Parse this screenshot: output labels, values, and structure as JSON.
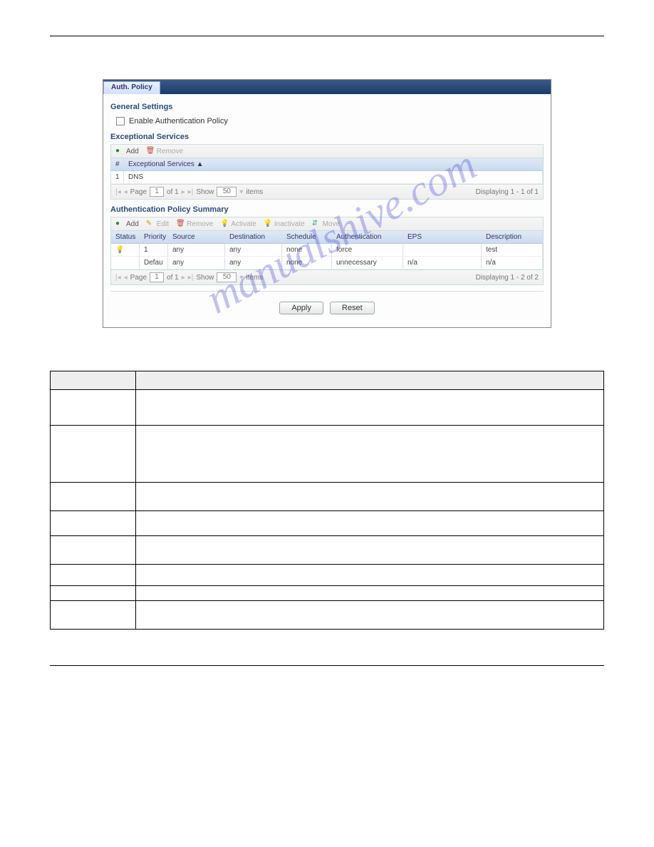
{
  "tab": {
    "label": "Auth. Policy"
  },
  "general": {
    "title": "General Settings",
    "checkbox_label": "Enable Authentication Policy"
  },
  "exceptional": {
    "title": "Exceptional Services",
    "add_label": "Add",
    "remove_label": "Remove",
    "col_num": "#",
    "col_name": "Exceptional Services ▲",
    "rows": [
      {
        "num": "1",
        "name": "DNS"
      }
    ],
    "pager": {
      "page_label": "Page",
      "of_label": "of 1",
      "show_label": "Show",
      "items_label": "items",
      "page_val": "1",
      "size_val": "50",
      "display": "Displaying 1 - 1 of 1"
    }
  },
  "summary": {
    "title": "Authentication Policy Summary",
    "add_label": "Add",
    "edit_label": "Edit",
    "remove_label": "Remove",
    "activate_label": "Activate",
    "inactivate_label": "Inactivate",
    "move_label": "Move",
    "cols": {
      "status": "Status",
      "priority": "Priority",
      "source": "Source",
      "destination": "Destination",
      "schedule": "Schedule",
      "authentication": "Authentication",
      "eps": "EPS",
      "description": "Description"
    },
    "rows": [
      {
        "status": "on",
        "priority": "1",
        "source": "any",
        "destination": "any",
        "schedule": "none",
        "authentication": "force",
        "eps": "",
        "description": "test"
      },
      {
        "status": "",
        "priority": "Defau",
        "source": "any",
        "destination": "any",
        "schedule": "none",
        "authentication": "unnecessary",
        "eps": "n/a",
        "description": "n/a"
      }
    ],
    "pager": {
      "page_label": "Page",
      "of_label": "of 1",
      "show_label": "Show",
      "items_label": "items",
      "page_val": "1",
      "size_val": "50",
      "display": "Displaying 1 - 2 of 2"
    }
  },
  "actions": {
    "apply": "Apply",
    "reset": "Reset"
  },
  "watermark": "manualshive.com",
  "desc_headers": {
    "label": "",
    "desc": ""
  }
}
